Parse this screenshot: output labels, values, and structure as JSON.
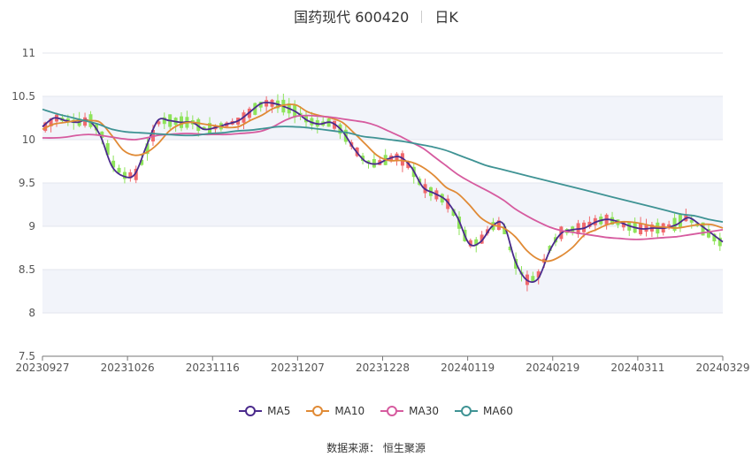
{
  "title": {
    "name": "国药现代 600420",
    "period": "日K"
  },
  "source": {
    "label": "数据来源：",
    "value": "恒生聚源"
  },
  "chart_data": {
    "type": "candlestick",
    "y_ticks": [
      "11",
      "10.5",
      "10",
      "9.5",
      "9",
      "8.5",
      "8",
      "7.5"
    ],
    "y_range": [
      7.5,
      11
    ],
    "x_ticks": [
      "20230927",
      "20231026",
      "20231116",
      "20231207",
      "20231228",
      "20240119",
      "20240219",
      "20240311",
      "20240329"
    ],
    "grid": true,
    "legend_position": "bottom",
    "colors": {
      "up": "#f0696d",
      "down": "#8ee35a",
      "band": "#f2f4fa"
    },
    "series": [
      {
        "name": "MA5",
        "color": "#4a2a8c",
        "values": [
          10.15,
          10.25,
          10.22,
          10.2,
          10.22,
          10.05,
          9.7,
          9.58,
          9.6,
          9.92,
          10.22,
          10.22,
          10.2,
          10.2,
          10.12,
          10.14,
          10.18,
          10.22,
          10.32,
          10.42,
          10.42,
          10.38,
          10.32,
          10.22,
          10.18,
          10.2,
          10.1,
          9.9,
          9.75,
          9.72,
          9.78,
          9.8,
          9.68,
          9.45,
          9.38,
          9.3,
          9.1,
          8.8,
          8.82,
          9.0,
          9.02,
          8.6,
          8.38,
          8.4,
          8.72,
          8.92,
          8.96,
          8.98,
          9.05,
          9.08,
          9.05,
          9.0,
          8.97,
          8.98,
          8.98,
          9.02,
          9.1,
          9.02,
          8.92,
          8.82
        ]
      },
      {
        "name": "MA10",
        "color": "#e08a35",
        "values": [
          10.12,
          10.18,
          10.2,
          10.22,
          10.22,
          10.2,
          10.05,
          9.88,
          9.82,
          9.85,
          9.95,
          10.1,
          10.18,
          10.2,
          10.18,
          10.16,
          10.14,
          10.15,
          10.22,
          10.28,
          10.36,
          10.4,
          10.4,
          10.32,
          10.28,
          10.25,
          10.2,
          10.08,
          9.95,
          9.82,
          9.76,
          9.76,
          9.74,
          9.68,
          9.58,
          9.45,
          9.38,
          9.25,
          9.1,
          9.02,
          8.98,
          8.88,
          8.72,
          8.62,
          8.6,
          8.66,
          8.76,
          8.9,
          8.96,
          9.02,
          9.05,
          9.05,
          9.03,
          9.0,
          8.99,
          8.98,
          9.0,
          9.02,
          9.02,
          8.98
        ]
      },
      {
        "name": "MA30",
        "color": "#d65b9f",
        "values": [
          10.02,
          10.02,
          10.03,
          10.05,
          10.06,
          10.05,
          10.03,
          10.01,
          10.0,
          10.02,
          10.05,
          10.06,
          10.07,
          10.07,
          10.06,
          10.06,
          10.06,
          10.07,
          10.08,
          10.1,
          10.15,
          10.22,
          10.27,
          10.28,
          10.27,
          10.26,
          10.24,
          10.22,
          10.2,
          10.16,
          10.1,
          10.04,
          9.97,
          9.9,
          9.8,
          9.7,
          9.6,
          9.52,
          9.45,
          9.38,
          9.3,
          9.2,
          9.12,
          9.05,
          8.99,
          8.95,
          8.93,
          8.91,
          8.89,
          8.87,
          8.86,
          8.85,
          8.85,
          8.86,
          8.87,
          8.88,
          8.9,
          8.92,
          8.94,
          8.96
        ]
      },
      {
        "name": "MA60",
        "color": "#3f9394",
        "values": [
          10.35,
          10.3,
          10.26,
          10.22,
          10.18,
          10.12,
          10.09,
          10.08,
          10.07,
          10.06,
          10.05,
          10.05,
          10.07,
          10.08,
          10.1,
          10.11,
          10.13,
          10.15,
          10.15,
          10.14,
          10.12,
          10.1,
          10.08,
          10.04,
          10.02,
          10.0,
          9.98,
          9.95,
          9.92,
          9.88,
          9.82,
          9.76,
          9.7,
          9.66,
          9.62,
          9.58,
          9.54,
          9.5,
          9.46,
          9.42,
          9.38,
          9.34,
          9.3,
          9.26,
          9.22,
          9.18,
          9.14,
          9.12,
          9.08,
          9.05
        ]
      }
    ]
  }
}
